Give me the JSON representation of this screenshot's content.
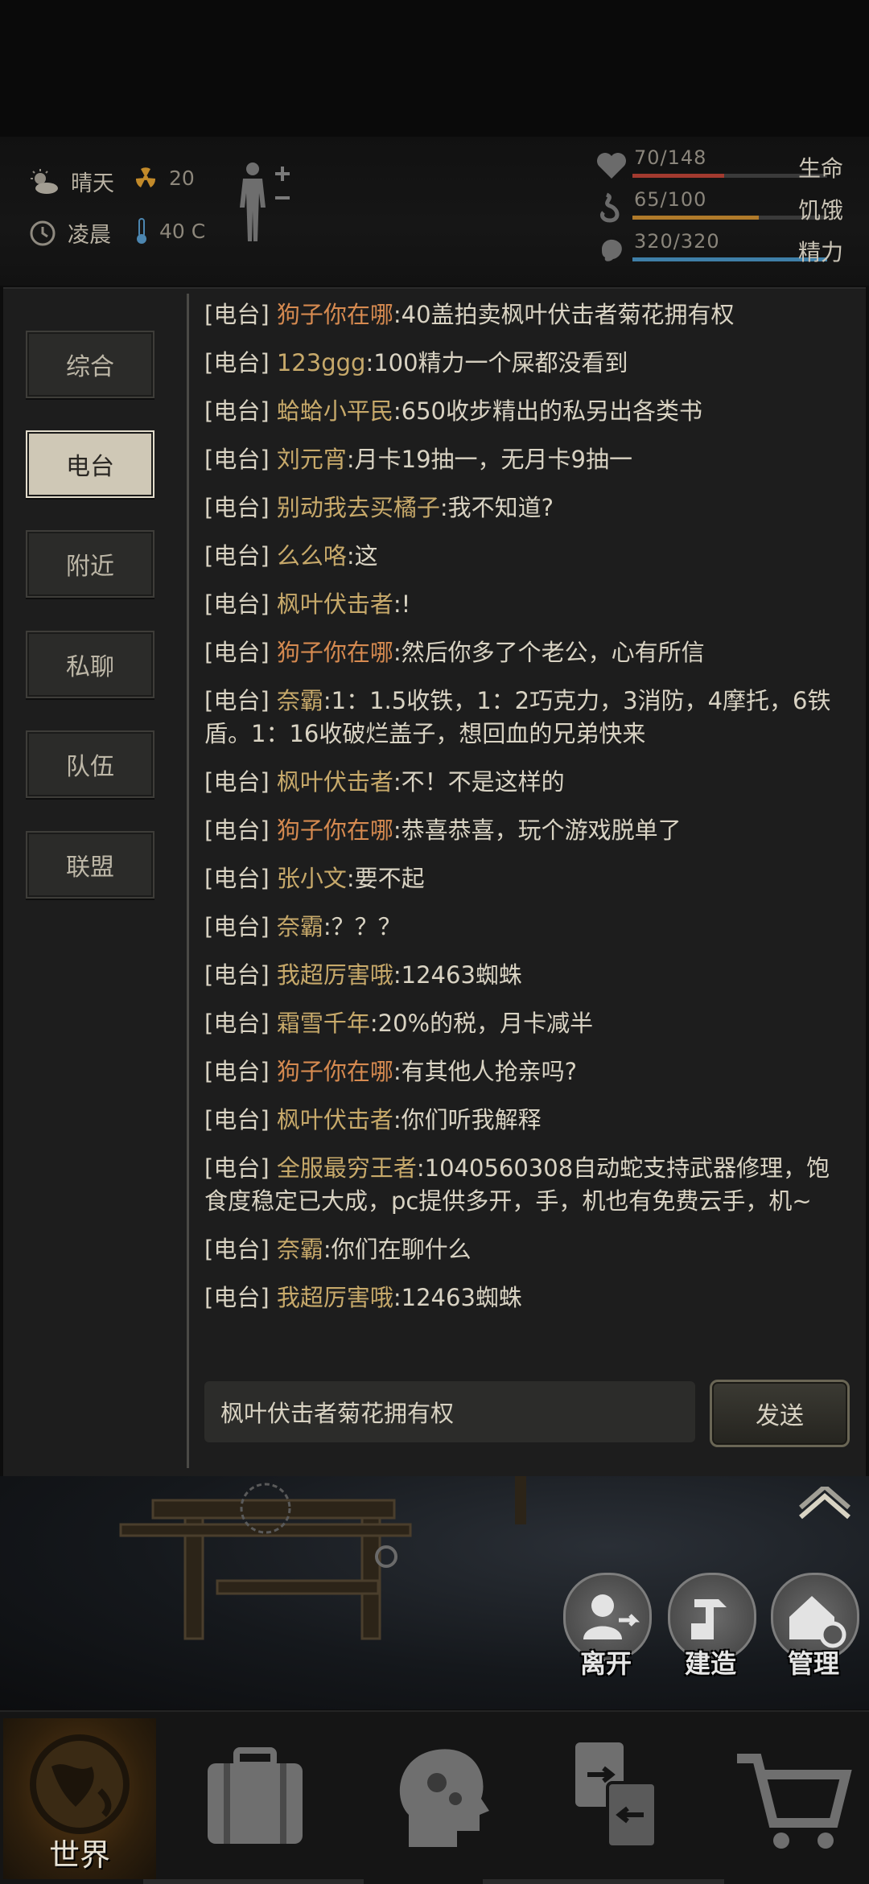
{
  "hud": {
    "weather": "晴天",
    "radiation": "20",
    "time_of_day": "凌晨",
    "temperature": "40 C",
    "life": {
      "text": "70/148",
      "label": "生命",
      "fraction": 0.473,
      "color": "#a33a2f"
    },
    "hunger": {
      "text": "65/100",
      "label": "饥饿",
      "fraction": 0.65,
      "color": "#b07a2a"
    },
    "energy": {
      "text": "320/320",
      "label": "精力",
      "fraction": 1.0,
      "color": "#3f7fa8"
    }
  },
  "tabs": [
    "综合",
    "电台",
    "附近",
    "私聊",
    "队伍",
    "联盟"
  ],
  "active_tab": "电台",
  "messages": [
    {
      "channel": "[电台]",
      "name": "狗子你在哪",
      "text": ":40盖拍卖枫叶伏击者菊花拥有权",
      "name_color": "orange"
    },
    {
      "channel": "[电台]",
      "name": "123ggg",
      "text": ":100精力一个屎都没看到",
      "name_color": "gold"
    },
    {
      "channel": "[电台]",
      "name": "蛤蛤小平民",
      "text": ":650收步精出的私另出各类书",
      "name_color": "gold"
    },
    {
      "channel": "[电台]",
      "name": "刘元宵",
      "text": ":月卡19抽一，无月卡9抽一",
      "name_color": "gold"
    },
    {
      "channel": "[电台]",
      "name": "别动我去买橘子",
      "text": ":我不知道?",
      "name_color": "gold"
    },
    {
      "channel": "[电台]",
      "name": "么么咯",
      "text": ":这",
      "name_color": "gold"
    },
    {
      "channel": "[电台]",
      "name": "枫叶伏击者",
      "text": ":!",
      "name_color": "gold"
    },
    {
      "channel": "[电台]",
      "name": "狗子你在哪",
      "text": ":然后你多了个老公，心有所信",
      "name_color": "orange"
    },
    {
      "channel": "[电台]",
      "name": "奈霸",
      "text": ":1：1.5收铁，1：2巧克力，3消防，4摩托，6铁盾。1：16收破烂盖子，想回血的兄弟快来",
      "name_color": "gold"
    },
    {
      "channel": "[电台]",
      "name": "枫叶伏击者",
      "text": ":不！不是这样的",
      "name_color": "gold"
    },
    {
      "channel": "[电台]",
      "name": "狗子你在哪",
      "text": ":恭喜恭喜，玩个游戏脱单了",
      "name_color": "orange"
    },
    {
      "channel": "[电台]",
      "name": "张小文",
      "text": ":要不起",
      "name_color": "gold"
    },
    {
      "channel": "[电台]",
      "name": "奈霸",
      "text": ":？？？",
      "name_color": "gold"
    },
    {
      "channel": "[电台]",
      "name": "我超厉害哦",
      "text": ":12463蜘蛛",
      "name_color": "gold"
    },
    {
      "channel": "[电台]",
      "name": "霜雪千年",
      "text": ":20%的税，月卡减半",
      "name_color": "gold"
    },
    {
      "channel": "[电台]",
      "name": "狗子你在哪",
      "text": ":有其他人抢亲吗?",
      "name_color": "orange"
    },
    {
      "channel": "[电台]",
      "name": "枫叶伏击者",
      "text": ":你们听我解释",
      "name_color": "gold"
    },
    {
      "channel": "[电台]",
      "name": "全服最穷王者",
      "text": ":1040560308自动蛇支持武器修理，饱食度稳定已大成，pc提供多开，手，机也有免费云手，机~",
      "name_color": "gold"
    },
    {
      "channel": "[电台]",
      "name": "奈霸",
      "text": ":你们在聊什么",
      "name_color": "gold"
    },
    {
      "channel": "[电台]",
      "name": "我超厉害哦",
      "text": ":12463蜘蛛",
      "name_color": "gold"
    }
  ],
  "chat_input": {
    "value": "枫叶伏击者菊花拥有权"
  },
  "send_label": "发送",
  "actions": [
    {
      "label": "离开",
      "icon": "leave-icon"
    },
    {
      "label": "建造",
      "icon": "build-icon"
    },
    {
      "label": "管理",
      "icon": "manage-icon"
    }
  ],
  "nav": {
    "world": "世界"
  }
}
